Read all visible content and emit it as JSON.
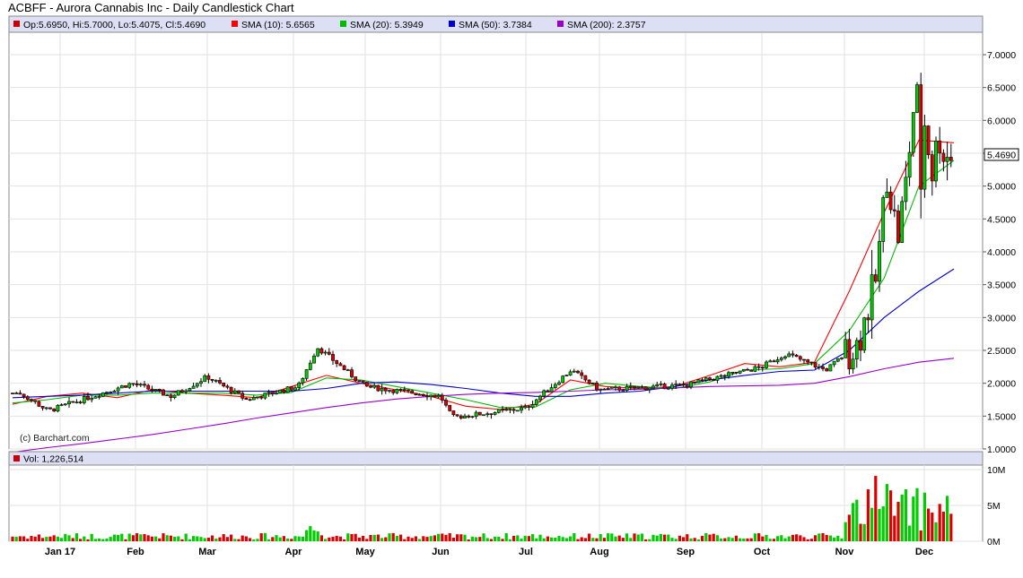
{
  "header": {
    "title": "ACBFF - Aurora Cannabis Inc - Daily Candlestick Chart"
  },
  "legend": {
    "ohlc": {
      "text": "Op:5.6950, Hi:5.7000, Lo:5.4075, Cl:5.4690",
      "color": "#cc0000"
    },
    "sma10": {
      "text": "SMA (10): 5.6565",
      "color": "#ff0000"
    },
    "sma20": {
      "text": "SMA (20): 5.3949",
      "color": "#00bb00"
    },
    "sma50": {
      "text": "SMA (50): 3.7384",
      "color": "#0000cc"
    },
    "sma200": {
      "text": "SMA (200): 2.3757",
      "color": "#9900cc"
    }
  },
  "credit": "(c) Barchart.com",
  "last_price_label": "5.4690",
  "volume_legend": {
    "text": "Vol: 1,226,514",
    "color": "#cc0000"
  },
  "chart_data": {
    "type": "candlestick",
    "price_axis": {
      "min": 1.0,
      "max": 7.0,
      "ticks": [
        "1.0000",
        "1.5000",
        "2.0000",
        "2.5000",
        "3.0000",
        "3.5000",
        "4.0000",
        "4.5000",
        "5.0000",
        "5.5000",
        "6.0000",
        "6.5000",
        "7.0000"
      ]
    },
    "volume_axis": {
      "min": 0,
      "max": 10,
      "unit": "M",
      "ticks": [
        "0M",
        "5M",
        "10M"
      ]
    },
    "months": [
      "Jan 17",
      "Feb",
      "Mar",
      "Apr",
      "May",
      "Jun",
      "Jul",
      "Aug",
      "Sep",
      "Oct",
      "Nov",
      "Dec"
    ],
    "key_points": [
      {
        "date": "Jan 3",
        "close": 1.85
      },
      {
        "date": "Jan 10",
        "close": 1.58
      },
      {
        "date": "Jan 31",
        "close": 2.0
      },
      {
        "date": "Feb 15",
        "close": 1.8
      },
      {
        "date": "Mar 1",
        "close": 2.1
      },
      {
        "date": "Mar 15",
        "close": 1.75
      },
      {
        "date": "Apr 3",
        "close": 1.95
      },
      {
        "date": "Apr 11",
        "close": 2.55
      },
      {
        "date": "May 1",
        "close": 1.95
      },
      {
        "date": "Jun 1",
        "close": 1.8
      },
      {
        "date": "Jun 5",
        "close": 1.48
      },
      {
        "date": "Jul 1",
        "close": 1.62
      },
      {
        "date": "Jul 20",
        "close": 2.2
      },
      {
        "date": "Aug 1",
        "close": 1.9
      },
      {
        "date": "Sep 1",
        "close": 1.97
      },
      {
        "date": "Oct 1",
        "close": 2.25
      },
      {
        "date": "Oct 10",
        "close": 2.45
      },
      {
        "date": "Oct 25",
        "close": 2.2
      },
      {
        "date": "Nov 6",
        "close": 2.6
      },
      {
        "date": "Nov 13",
        "close": 3.6
      },
      {
        "date": "Nov 17",
        "close": 5.2
      },
      {
        "date": "Nov 21",
        "close": 4.2
      },
      {
        "date": "Nov 24",
        "close": 5.0
      },
      {
        "date": "Nov 28",
        "close": 6.6
      },
      {
        "date": "Nov 30",
        "close": 4.8
      },
      {
        "date": "Dec 1",
        "close": 6.0
      },
      {
        "date": "Dec 5",
        "close": 5.2
      },
      {
        "date": "Dec 8",
        "close": 5.8
      },
      {
        "date": "Dec 11",
        "close": 5.47
      }
    ],
    "sma_series": [
      {
        "name": "SMA (10)",
        "color": "#ff0000",
        "values": [
          1.68,
          1.8,
          1.85,
          1.78,
          1.9,
          1.85,
          1.82,
          1.78,
          1.95,
          2.12,
          2.0,
          1.9,
          1.8,
          1.65,
          1.6,
          1.68,
          2.05,
          1.95,
          1.92,
          1.95,
          2.12,
          2.3,
          2.25,
          2.32,
          3.4,
          4.6,
          5.7,
          5.66
        ]
      },
      {
        "name": "SMA (20)",
        "color": "#00bb00",
        "values": [
          1.7,
          1.75,
          1.82,
          1.82,
          1.85,
          1.85,
          1.85,
          1.82,
          1.86,
          2.08,
          2.05,
          1.95,
          1.85,
          1.75,
          1.63,
          1.64,
          1.9,
          2.0,
          1.95,
          1.92,
          2.02,
          2.2,
          2.22,
          2.3,
          2.8,
          3.6,
          5.0,
          5.39
        ]
      },
      {
        "name": "SMA (50)",
        "color": "#0000cc",
        "values": [
          1.78,
          1.8,
          1.82,
          1.85,
          1.88,
          1.88,
          1.88,
          1.88,
          1.88,
          1.92,
          2.0,
          2.02,
          1.98,
          1.92,
          1.85,
          1.8,
          1.8,
          1.85,
          1.88,
          1.95,
          2.05,
          2.12,
          2.18,
          2.2,
          2.5,
          3.0,
          3.4,
          3.74
        ]
      },
      {
        "name": "SMA (200)",
        "color": "#9900cc",
        "values": [
          0.95,
          1.02,
          1.08,
          1.15,
          1.22,
          1.3,
          1.38,
          1.47,
          1.55,
          1.63,
          1.7,
          1.76,
          1.8,
          1.83,
          1.85,
          1.86,
          1.88,
          1.9,
          1.91,
          1.93,
          1.95,
          1.96,
          1.97,
          2.0,
          2.1,
          2.22,
          2.32,
          2.38
        ]
      }
    ]
  }
}
